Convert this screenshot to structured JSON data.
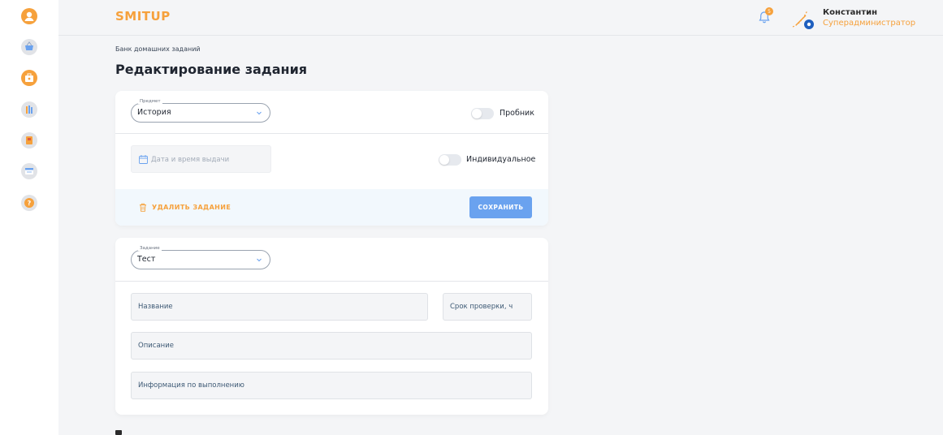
{
  "app": {
    "logo": "SMITUP"
  },
  "sidebar": {
    "items": [
      {
        "name": "profile",
        "icon": "user-icon"
      },
      {
        "name": "shop",
        "icon": "basket-icon"
      },
      {
        "name": "work",
        "icon": "briefcase-icon"
      },
      {
        "name": "library",
        "icon": "books-icon"
      },
      {
        "name": "notebook",
        "icon": "notebook-icon"
      },
      {
        "name": "schedule",
        "icon": "calendar-icon"
      },
      {
        "name": "help",
        "icon": "question-icon"
      }
    ]
  },
  "header": {
    "notifications_count": "5",
    "user_name": "Константин",
    "user_role": "Суперадминистратор"
  },
  "breadcrumb": "Банк домашних заданий",
  "page_title": "Редактирование задания",
  "card1": {
    "subject": {
      "label": "Предмет",
      "value": "История"
    },
    "trial": {
      "label": "Пробник",
      "checked": false
    },
    "date": {
      "placeholder": "Дата и время выдачи"
    },
    "individual": {
      "label": "Индивидуальное",
      "checked": false
    },
    "delete_label": "УДАЛИТЬ ЗАДАНИЕ",
    "save_label": "СОХРАНИТЬ"
  },
  "card2": {
    "task": {
      "label": "Задание",
      "value": "Тест"
    },
    "name_placeholder": "Название",
    "deadline_placeholder": "Срок проверки, ч",
    "description_placeholder": "Описание",
    "info_placeholder": "Информация по выполнению"
  },
  "colors": {
    "accent": "#f6a13c",
    "primary": "#6aa2ef",
    "background": "#f4f5f7"
  }
}
